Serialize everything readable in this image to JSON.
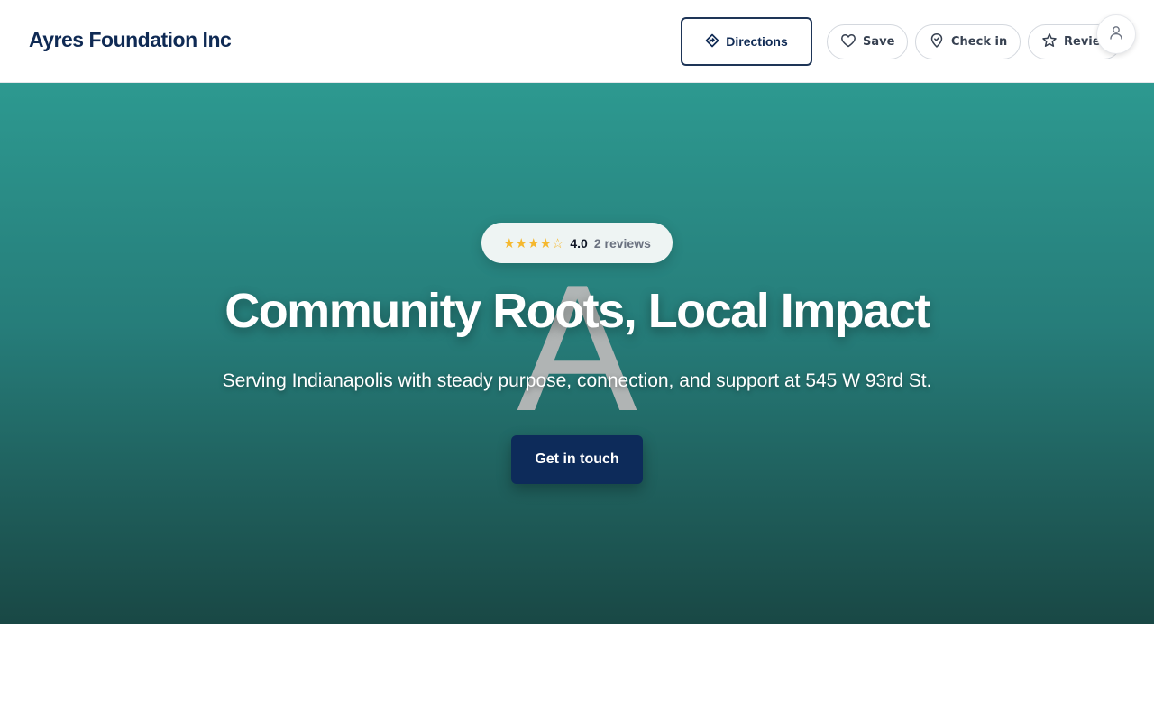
{
  "header": {
    "brand": "Ayres Foundation Inc",
    "directions_label": "Directions",
    "save_label": "Save",
    "checkin_label": "Check in",
    "review_label": "Review"
  },
  "hero": {
    "watermark_letter": "A",
    "rating": {
      "stars": "★★★★☆",
      "value": "4.0",
      "count": "2 reviews"
    },
    "title": "Community Roots, Local Impact",
    "subtitle": "Serving Indianapolis with steady purpose, connection, and support at 545 W 93rd St.",
    "cta_label": "Get in touch"
  },
  "colors": {
    "brand": "#0f2a54",
    "hero_top": "#2d9990",
    "hero_bottom": "#194845",
    "cta": "#0d2b5a",
    "star": "#f5b82e"
  },
  "icons": {
    "directions": "directions-icon",
    "save": "heart-icon",
    "checkin": "location-pin-icon",
    "review": "star-icon",
    "avatar": "user-icon"
  }
}
